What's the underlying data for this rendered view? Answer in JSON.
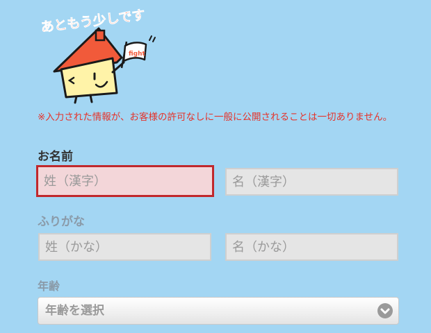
{
  "mascot": {
    "banner_text": "あともう少しです",
    "flag_text": "fight"
  },
  "notice": "※入力された情報が、お客様の許可なしに一般に公開されることは一切ありません。",
  "name_section": {
    "label": "お名前",
    "last_name_placeholder": "姓（漢字）",
    "first_name_placeholder": "名（漢字）"
  },
  "kana_section": {
    "label": "ふりがな",
    "last_name_placeholder": "姓（かな）",
    "first_name_placeholder": "名（かな）"
  },
  "age_section": {
    "label": "年齢",
    "select_text": "年齢を選択"
  },
  "colors": {
    "background": "#a3d6f3",
    "error_border": "#c0282c",
    "notice_text": "#e5332a",
    "accent": "#f15a3a"
  }
}
